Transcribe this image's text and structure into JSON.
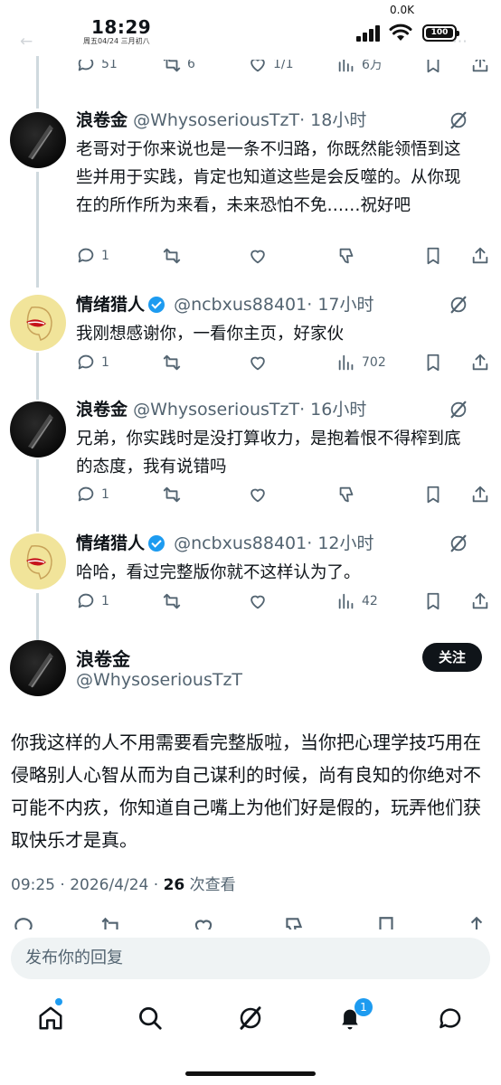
{
  "status": {
    "time": "18:29",
    "date": "周五04/24 三月初八",
    "speed": "0.0K",
    "battery": "100"
  },
  "top_row": {
    "reply_count": "51",
    "repost_count": "6",
    "like_count": "1/1",
    "view_count": "6万"
  },
  "replies": [
    {
      "name": "浪卷金",
      "handle": "@WhysoseriousTzT",
      "time": "· 18小时",
      "verified": false,
      "text": "老哥对于你来说也是一条不归路，你既然能领悟到这些并用于实践，肯定也知道这些是会反噬的。从你现在的所作所为来看，未来恐怕不免……祝好吧",
      "reply_count": "1",
      "views": ""
    },
    {
      "name": "情绪猎人",
      "handle": "@ncbxus88401",
      "time": "· 17小时",
      "verified": true,
      "text": "我刚想感谢你，一看你主页，好家伙",
      "reply_count": "1",
      "views": "702"
    },
    {
      "name": "浪卷金",
      "handle": "@WhysoseriousTzT",
      "time": "· 16小时",
      "verified": false,
      "text": "兄弟，你实践时是没打算收力，是抱着恨不得榨到底的态度，我有说错吗",
      "reply_count": "1",
      "views": ""
    },
    {
      "name": "情绪猎人",
      "handle": "@ncbxus88401",
      "time": "· 12小时",
      "verified": true,
      "text": "哈哈，看过完整版你就不这样认为了。",
      "reply_count": "1",
      "views": "42"
    }
  ],
  "main_tweet": {
    "name": "浪卷金",
    "handle": "@WhysoseriousTzT",
    "follow_label": "关注",
    "text": "你我这样的人不用需要看完整版啦，当你把心理学技巧用在侵略别人心智从而为自己谋利的时候，尚有良知的你绝对不可能不内疚，你知道自己嘴上为他们好是假的，玩弄他们获取快乐才是真。",
    "timestamp": "09:25 · 2026/4/24 · ",
    "view_count": "26",
    "view_label": " 次查看"
  },
  "compose": {
    "placeholder": "发布你的回复"
  },
  "tabbar": {
    "notification_count": "1"
  },
  "colors": {
    "accent": "#1d9bf0",
    "text": "#0f1419",
    "muted": "#536471"
  }
}
